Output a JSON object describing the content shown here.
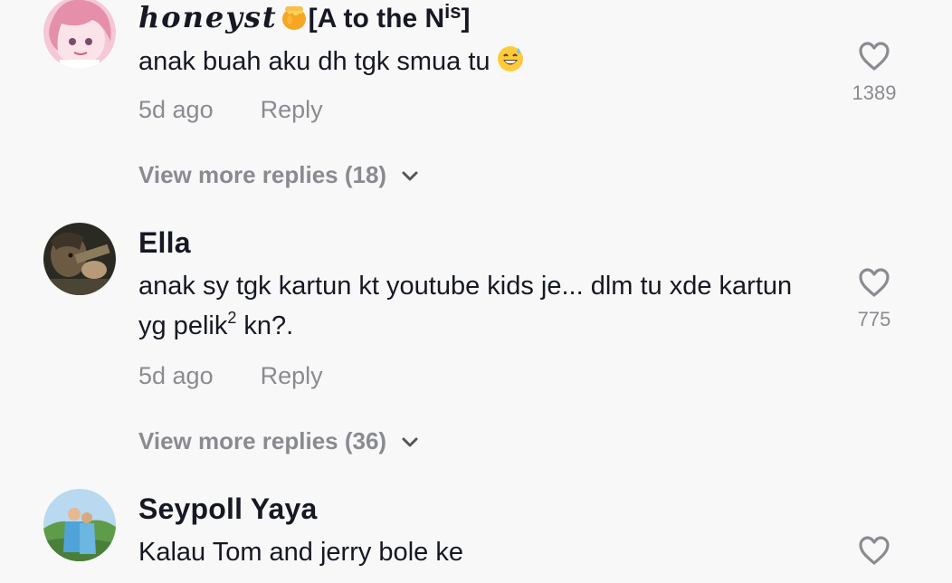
{
  "comments": [
    {
      "username": "honeyst",
      "username_suffix_main": "[A to the N",
      "username_suffix_sup": "is",
      "username_suffix_end": "]",
      "text": "anak buah aku dh tgk smua tu",
      "emoji": "grinning-sweat-emoji",
      "time": "5d ago",
      "reply": "Reply",
      "likes": "1389",
      "view_more": "View more replies (18)"
    },
    {
      "username": "Ella",
      "text_part1": "anak sy tgk kartun kt youtube kids je... dlm tu xde kartun yg pelik",
      "text_sup": "2",
      "text_part2": " kn?.",
      "time": "5d ago",
      "reply": "Reply",
      "likes": "775",
      "view_more": "View more replies (36)"
    },
    {
      "username": "Seypoll Yaya",
      "text": "Kalau Tom and jerry bole ke"
    }
  ],
  "icons": {
    "like": "heart-outline-icon",
    "expand": "chevron-down-icon",
    "honey": "honey-pot-icon"
  },
  "colors": {
    "background": "#f8f8f8",
    "primary_text": "#161823",
    "secondary_text": "#8a8b91"
  }
}
